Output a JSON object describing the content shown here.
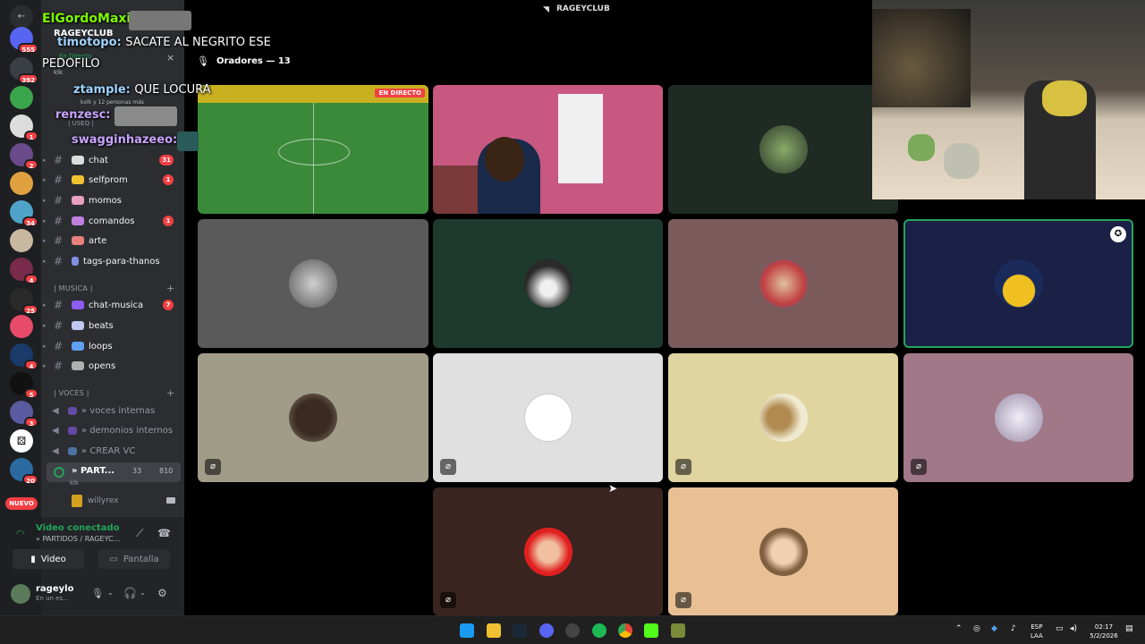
{
  "window": {
    "title": "RAGEYCLUB"
  },
  "server": {
    "name": "RAGEYCLUB"
  },
  "rail": {
    "badges": [
      "555",
      "392",
      "1",
      "2",
      "34",
      "4",
      "25",
      "4",
      "5",
      "3",
      "20"
    ],
    "new_label": "NUEVO"
  },
  "channels": [
    {
      "name": "chat",
      "count": "31"
    },
    {
      "name": "selfprom",
      "count": "1"
    },
    {
      "name": "momos",
      "count": ""
    },
    {
      "name": "comandos",
      "count": "1"
    },
    {
      "name": "arte",
      "count": ""
    },
    {
      "name": "tags-para-thanos",
      "count": ""
    }
  ],
  "music_category": "| MUSICA |",
  "music_channels": [
    {
      "name": "chat-musica",
      "count": "7"
    },
    {
      "name": "beats",
      "count": ""
    },
    {
      "name": "loops",
      "count": ""
    },
    {
      "name": "opens",
      "count": ""
    }
  ],
  "voice_category": "| VOCES |",
  "voice_channels": [
    "» voces internas",
    "» demonios internos",
    "» CREAR VC"
  ],
  "active_voice": {
    "name": "» PART...",
    "cam_count": "33",
    "listeners": "810",
    "sub": "klk",
    "member": "willyrex"
  },
  "voice_panel": {
    "status": "Video conectado",
    "location": "» PARTIDOS / RAGEYC...",
    "video_label": "Video",
    "screen_label": "Pantalla"
  },
  "user": {
    "name": "rageylo",
    "status": "En un es..."
  },
  "stage": {
    "speakers_label": "Oradores — 13",
    "live_label": "EN DIRECTO"
  },
  "overlay": {
    "lines": [
      {
        "user": "ElGordoMaxi:",
        "msg": "",
        "color": "#7cfc00"
      },
      {
        "user": "timotopo:",
        "msg": "SACATE AL NEGRITO ESE",
        "color": "#9fd3ff"
      },
      {
        "user": "",
        "msg": "PEDOFILO",
        "color": "#ffffff"
      },
      {
        "user": "ztample:",
        "msg": "QUE LOCURA",
        "color": "#9fd3ff"
      },
      {
        "user": "renzesc:",
        "msg": "",
        "color": "#c9a4ff"
      },
      {
        "user": "swagginhazeeo:",
        "msg": "",
        "color": "#c9a4ff"
      }
    ],
    "small_text": [
      "En Directo",
      "klk",
      "kxlk y 12 personas más",
      "| USEQ |"
    ]
  },
  "taskbar": {
    "lang_top": "ESP",
    "lang_bottom": "LAA",
    "time": "02:17",
    "date": "5/2/2026"
  },
  "colors": {
    "accent": "#5865f2",
    "online": "#23a55a",
    "danger": "#f23f43"
  }
}
